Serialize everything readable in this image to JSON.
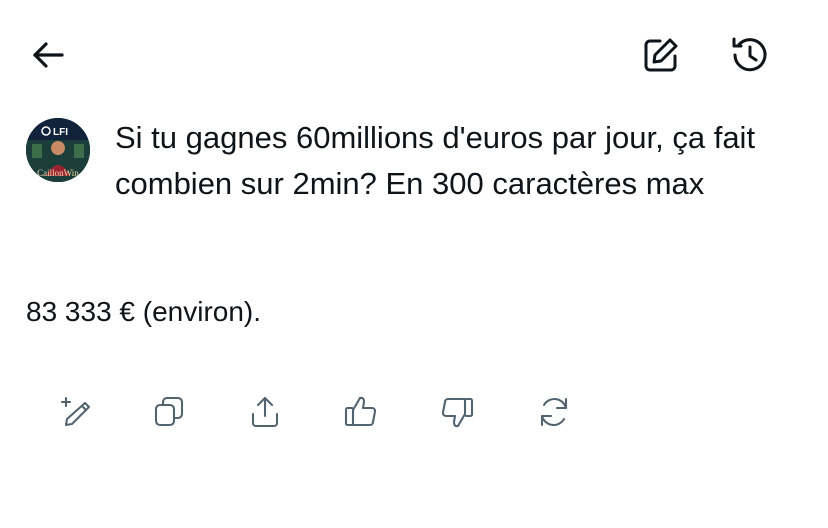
{
  "header": {
    "back_icon": "arrow-left-icon",
    "compose_icon": "edit-square-icon",
    "history_icon": "history-clock-icon"
  },
  "user_message": {
    "avatar_text_top": "LFI",
    "avatar_text_bottom": "CaillonWin",
    "text": "Si tu gagnes 60millions d'euros par jour, ça fait combien sur 2min? En 300 caractères max"
  },
  "assistant_message": {
    "text": "83 333 € (environ)."
  },
  "actions": [
    {
      "icon": "rewrite-sparkle-pen-icon"
    },
    {
      "icon": "copy-icon"
    },
    {
      "icon": "share-icon"
    },
    {
      "icon": "thumbs-up-icon"
    },
    {
      "icon": "thumbs-down-icon"
    },
    {
      "icon": "regenerate-icon"
    }
  ],
  "colors": {
    "text": "#0f1419",
    "icon_muted": "#536471",
    "background": "#ffffff"
  }
}
